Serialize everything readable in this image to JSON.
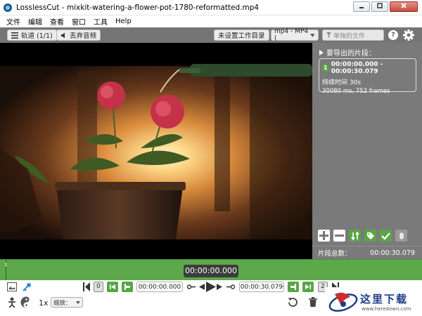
{
  "window": {
    "title": "LosslessCut - mixkit-watering-a-flower-pot-1780-reformatted.mp4",
    "minimize": "0",
    "maximize": "1",
    "close": "r"
  },
  "menu": [
    "文件",
    "编辑",
    "查看",
    "窗口",
    "工具",
    "Help"
  ],
  "toolbar": {
    "tracks_label": "轨道 (1/1)",
    "discard_audio_label": "丢弃音频",
    "working_dir_label": "未设置工作目录",
    "format_value": "mp4 - MP4 (",
    "filename_placeholder": "单独的文件",
    "help_label": "?"
  },
  "segments": {
    "header": "要导出的片段：",
    "items": [
      {
        "number": "1",
        "range": "00:00:00.000 - 00:00:30.079",
        "duration": "持续时间 30s",
        "details": "30080 ms, 752 frames"
      }
    ],
    "total_label": "片段总数：",
    "total_value": "00:00:30.079"
  },
  "timeline": {
    "current_time": "00:00:00.000",
    "start_marker": "1"
  },
  "controls": {
    "seg_start_number": "0",
    "cut_start": "00:00:00.000",
    "cut_end": "00:00:30.079",
    "seg_end_number": "2",
    "speed": "1x",
    "zoom_label": "缩放："
  },
  "watermark": {
    "text": "这里下载",
    "url": "www.heredown.com"
  },
  "colors": {
    "accent_green": "#5aa545",
    "panel_gray": "#7a7a7a",
    "toolbar_gray": "#757575"
  }
}
